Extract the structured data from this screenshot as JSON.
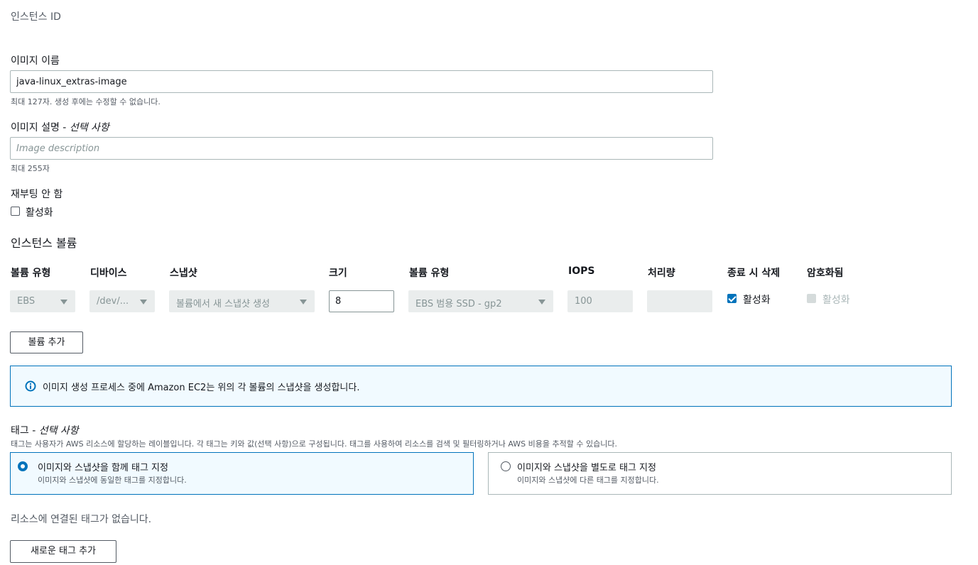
{
  "instance_id": {
    "label": "인스턴스 ID"
  },
  "image_name": {
    "label": "이미지 이름",
    "value": "java-linux_extras-image",
    "hint": "최대 127자. 생성 후에는 수정할 수 없습니다."
  },
  "image_description": {
    "label": "이미지 설명 - ",
    "label_optional": "선택 사항",
    "placeholder": "Image description",
    "hint": "최대 255자"
  },
  "no_reboot": {
    "label": "재부팅 안 함",
    "checkbox_label": "활성화",
    "checked": false
  },
  "instance_volumes": {
    "title": "인스턴스 볼륨",
    "headers": [
      "볼륨 유형",
      "디바이스",
      "스냅샷",
      "크기",
      "볼륨 유형",
      "IOPS",
      "처리량",
      "종료 시 삭제",
      "암호화됨"
    ],
    "row": {
      "volume_type": "EBS",
      "device": "/dev/...",
      "snapshot": "볼륨에서 새 스냅샷 생성",
      "size": "8",
      "ebs_type": "EBS 범용 SSD - gp2",
      "iops": "100",
      "throughput": "",
      "delete_on_termination": {
        "label": "활성화",
        "checked": true
      },
      "encrypted": {
        "label": "활성화",
        "checked": false,
        "disabled": true
      }
    },
    "add_volume_button": "볼륨 추가"
  },
  "info_alert": {
    "icon": "info-icon",
    "text": "이미지 생성 프로세스 중에 Amazon EC2는 위의 각 볼륨의 스냅샷을 생성합니다."
  },
  "tags": {
    "label": "태그 - ",
    "label_optional": "선택 사항",
    "description": "태그는 사용자가 AWS 리소스에 할당하는 레이블입니다. 각 태그는 키와 값(선택 사항)으로 구성됩니다. 태그를 사용하여 리소스를 검색 및 필터링하거나 AWS 비용을 추적할 수 있습니다.",
    "options": [
      {
        "title": "이미지와 스냅샷을 함께 태그 지정",
        "desc": "이미지와 스냅샷에 동일한 태그를 지정합니다.",
        "selected": true
      },
      {
        "title": "이미지와 스냅샷을 별도로 태그 지정",
        "desc": "이미지와 스냅샷에 다른 태그를 지정합니다.",
        "selected": false
      }
    ],
    "empty_text": "리소스에 연결된 태그가 없습니다.",
    "add_tag_button": "새로운 태그 추가"
  },
  "colors": {
    "accent": "#0073bb",
    "border": "#aab7b8",
    "muted": "#545b64",
    "disabled_bg": "#eaeded",
    "info_bg": "#f1faff"
  }
}
